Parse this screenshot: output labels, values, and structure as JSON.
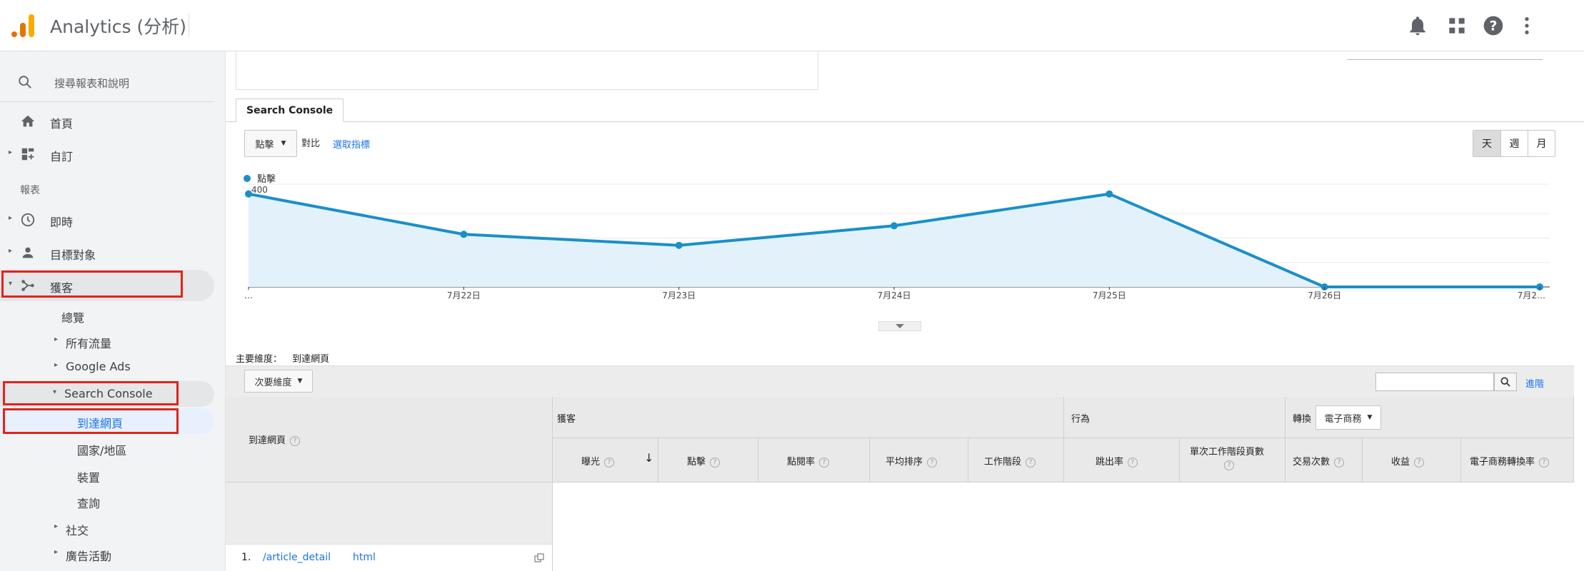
{
  "app": {
    "title": "Analytics (分析)"
  },
  "topbar": {
    "icons": [
      "bell-icon",
      "apps-grid-icon",
      "help-icon",
      "more-vert-icon"
    ]
  },
  "sidebar": {
    "search_placeholder": "搜尋報表和說明",
    "home": "首頁",
    "customize": "自訂",
    "reports_section": "報表",
    "realtime": "即時",
    "audience": "目標對象",
    "acquisition": "獲客",
    "acq_sub": {
      "overview": "總覽",
      "all_traffic": "所有流量",
      "google_ads": "Google Ads",
      "search_console": "Search Console",
      "sc_items": [
        "到達網頁",
        "國家/地區",
        "裝置",
        "查詢"
      ],
      "social": "社交",
      "campaigns": "廣告活動"
    }
  },
  "main": {
    "tab": "Search Console",
    "metric_select": "點擊",
    "vs_label": "對比",
    "select_metric_link": "選取指標",
    "periods": [
      "天",
      "週",
      "月"
    ],
    "legend": "點擊",
    "primary_dim_label": "主要維度：",
    "primary_dim_value": "到達網頁",
    "secondary_dim": "次要維度",
    "advanced": "進階",
    "ecommerce_select": "電子商務",
    "table": {
      "landing_page_header": "到達網頁",
      "group_acquisition": "獲客",
      "group_behavior": "行為",
      "group_conversion": "轉換",
      "columns": [
        "曝光",
        "點擊",
        "點閱率",
        "平均排序",
        "工作階段",
        "跳出率",
        "單次工作階段頁數",
        "交易次數",
        "收益",
        "電子商務轉換率"
      ],
      "rows": [
        {
          "index": "1.",
          "page_start": "/article_detail",
          "page_end": "html"
        }
      ]
    }
  },
  "colors": {
    "accent": "#1a8fc9",
    "fill": "#e3f2fa",
    "highlight_red": "#e2231a",
    "link": "#1a73e8"
  },
  "chart_data": {
    "type": "area",
    "x": [
      "…",
      "7月22日",
      "7月23日",
      "7月24日",
      "7月25日",
      "7月26日",
      "7月2…"
    ],
    "series": [
      {
        "name": "點擊",
        "values": [
          380,
          215,
          170,
          250,
          380,
          0,
          0
        ]
      }
    ],
    "yticks": [
      "400",
      "200"
    ],
    "ylim": [
      0,
      420
    ],
    "grid": true,
    "legend": "top-left"
  }
}
